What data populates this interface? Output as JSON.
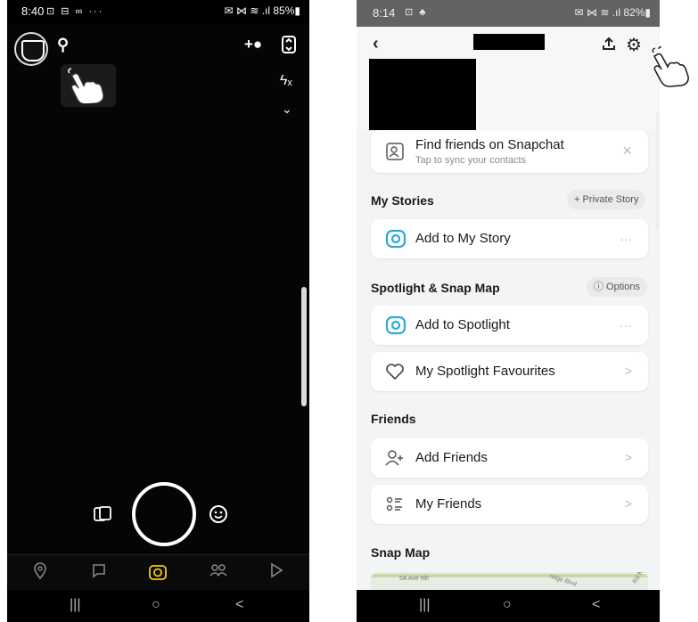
{
  "left": {
    "status": {
      "time": "8:40",
      "icons": "⊡ ⊟ ∞ ···",
      "right": "✉ ⋈ ≋ .ıl 85%▮"
    },
    "icons": {
      "avatar": "bitmoji-avatar",
      "search": "search-icon",
      "add_friend": "add-friend-icon",
      "flip": "flip-camera-icon",
      "flash": "flash-off-icon",
      "more": "chevron-down-icon",
      "memories": "memories-icon",
      "lens": "lens-smiley-icon"
    },
    "tabs": [
      "map-icon",
      "chat-icon",
      "camera-icon",
      "friends-icon",
      "discover-icon"
    ],
    "nav": [
      "|||",
      "○",
      "<"
    ]
  },
  "right": {
    "status": {
      "time": "8:14",
      "icons": "⊡ ♣",
      "right": "✉ ⋈ ≋ .ıl 82%▮"
    },
    "find_friends": {
      "title": "Find friends on Snapchat",
      "subtitle": "Tap to sync your contacts",
      "close": "×"
    },
    "my_stories": {
      "header": "My Stories",
      "pill": "+ Private Story",
      "add_label": "Add to My Story",
      "more": "···"
    },
    "spotlight": {
      "header": "Spotlight & Snap Map",
      "pill": "ⓘ Options",
      "add_label": "Add to Spotlight",
      "more": "···",
      "fav_label": "My Spotlight Favourites",
      "chev": ">"
    },
    "friends": {
      "header": "Friends",
      "add_label": "Add Friends",
      "my_label": "My Friends",
      "chev": ">"
    },
    "snap_map": {
      "header": "Snap Map",
      "street1": "5A Ave NE",
      "street2": "ridge Blvd",
      "street3": "Rd N"
    },
    "nav": [
      "|||",
      "○",
      "<"
    ]
  },
  "colors": {
    "accent": "#2ea8d8",
    "background": "#f3f4f6"
  }
}
